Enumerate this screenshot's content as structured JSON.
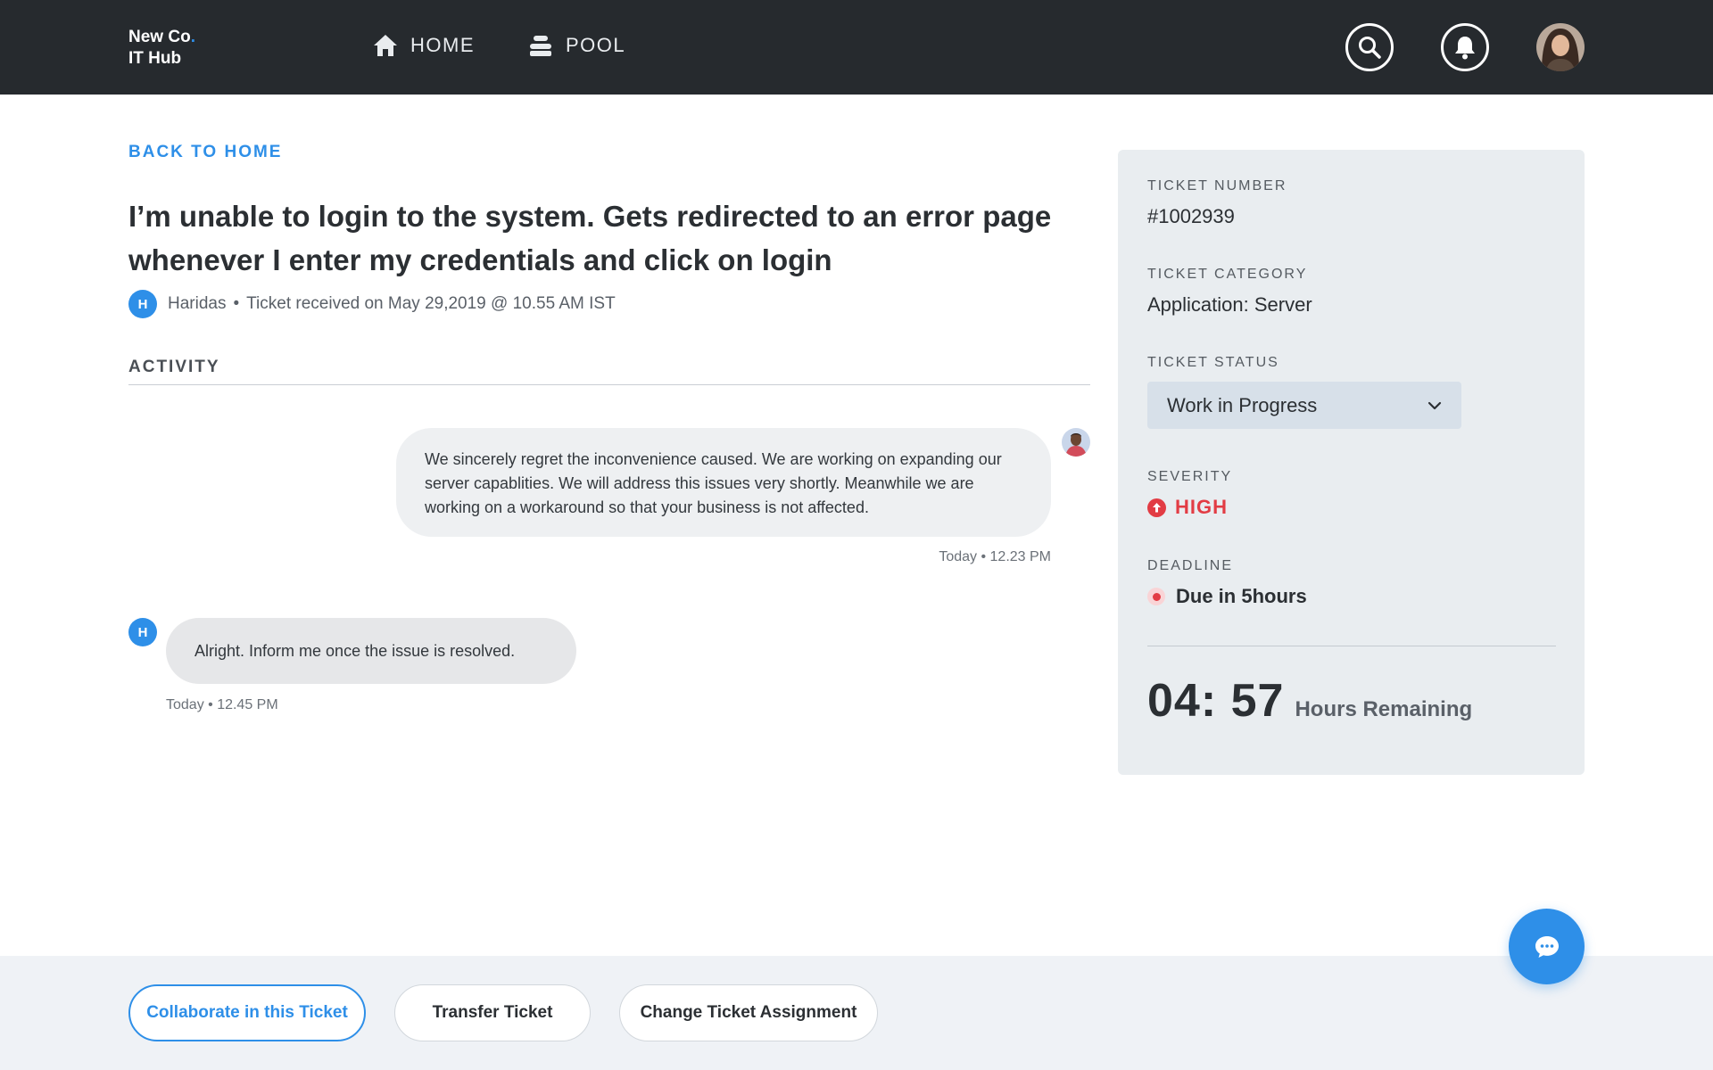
{
  "brand": {
    "line1": "New Co",
    "dot": ".",
    "line2": "IT Hub"
  },
  "nav": {
    "home": {
      "label": "HOME",
      "icon": "home-icon"
    },
    "pool": {
      "label": "POOL",
      "icon": "stack-icon"
    }
  },
  "header_actions": {
    "search_icon": "search-icon",
    "bell_icon": "bell-icon",
    "avatar": "user-avatar"
  },
  "back_link": "BACK TO HOME",
  "ticket": {
    "title": "I’m unable to login to the system. Gets redirected to an error page whenever I enter my credentials and click on login",
    "requester_initial": "H",
    "requester_name": "Haridas",
    "bullet": "•",
    "received": "Ticket received on May 29,2019 @ 10.55 AM IST"
  },
  "activity": {
    "label": "ACTIVITY",
    "messages": [
      {
        "from": "agent",
        "text": "We sincerely regret the inconvenience caused. We are working on expanding our server capablities. We will address this issues very shortly. Meanwhile we are working on a workaround so that your business is not affected.",
        "timestamp": "Today • 12.23 PM"
      },
      {
        "from": "requester",
        "initial": "H",
        "text": "Alright. Inform me once the issue is resolved.",
        "timestamp": "Today • 12.45 PM"
      }
    ]
  },
  "panel": {
    "number_label": "TICKET NUMBER",
    "number": "#1002939",
    "category_label": "TICKET CATEGORY",
    "category": "Application: Server",
    "status_label": "TICKET STATUS",
    "status": "Work in Progress",
    "severity_label": "SEVERITY",
    "severity": "HIGH",
    "deadline_label": "DEADLINE",
    "deadline": "Due in 5hours",
    "timer": "04: 57",
    "timer_caption": "Hours Remaining"
  },
  "actions": {
    "collaborate": "Collaborate in this Ticket",
    "transfer": "Transfer Ticket",
    "change_assignment": "Change Ticket Assignment"
  },
  "colors": {
    "accent": "#2e8fe8",
    "topbar": "#262a2e",
    "danger": "#e23c44",
    "panel": "#e9edf0"
  }
}
